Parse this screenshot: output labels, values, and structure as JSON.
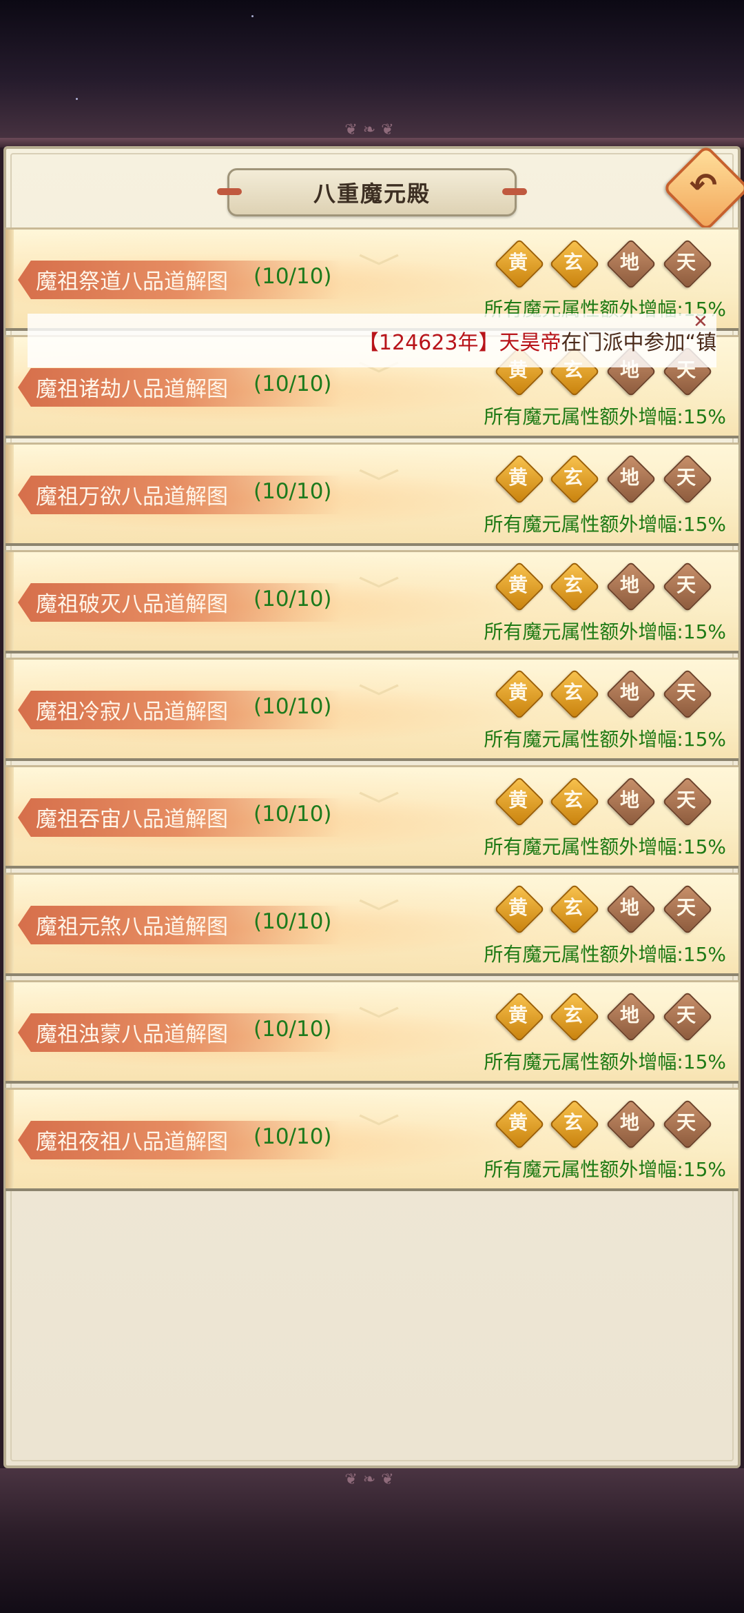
{
  "title": "八重魔元殿",
  "back_button_glyph": "↶",
  "rows": [
    {
      "name": "魔祖祭道八品道解图",
      "count": "(10/10)",
      "bonus": "所有魔元属性额外增幅:15%"
    },
    {
      "name": "魔祖诸劫八品道解图",
      "count": "(10/10)",
      "bonus": "所有魔元属性额外增幅:15%"
    },
    {
      "name": "魔祖万欲八品道解图",
      "count": "(10/10)",
      "bonus": "所有魔元属性额外增幅:15%"
    },
    {
      "name": "魔祖破灭八品道解图",
      "count": "(10/10)",
      "bonus": "所有魔元属性额外增幅:15%"
    },
    {
      "name": "魔祖冷寂八品道解图",
      "count": "(10/10)",
      "bonus": "所有魔元属性额外增幅:15%"
    },
    {
      "name": "魔祖吞宙八品道解图",
      "count": "(10/10)",
      "bonus": "所有魔元属性额外增幅:15%"
    },
    {
      "name": "魔祖元煞八品道解图",
      "count": "(10/10)",
      "bonus": "所有魔元属性额外增幅:15%"
    },
    {
      "name": "魔祖浊蒙八品道解图",
      "count": "(10/10)",
      "bonus": "所有魔元属性额外增幅:15%"
    },
    {
      "name": "魔祖夜祖八品道解图",
      "count": "(10/10)",
      "bonus": "所有魔元属性额外增幅:15%"
    }
  ],
  "tiers": [
    "黄",
    "玄",
    "地",
    "天"
  ],
  "tier_colors": {
    "active": "#e0a02a",
    "inactive": "#a56c4a"
  },
  "expand_glyph": "﹀",
  "marquee": {
    "year_part": "【124623年】",
    "name_part": "天昊帝",
    "rest_part": "在门派中参加“镇",
    "close_glyph": "✕"
  }
}
